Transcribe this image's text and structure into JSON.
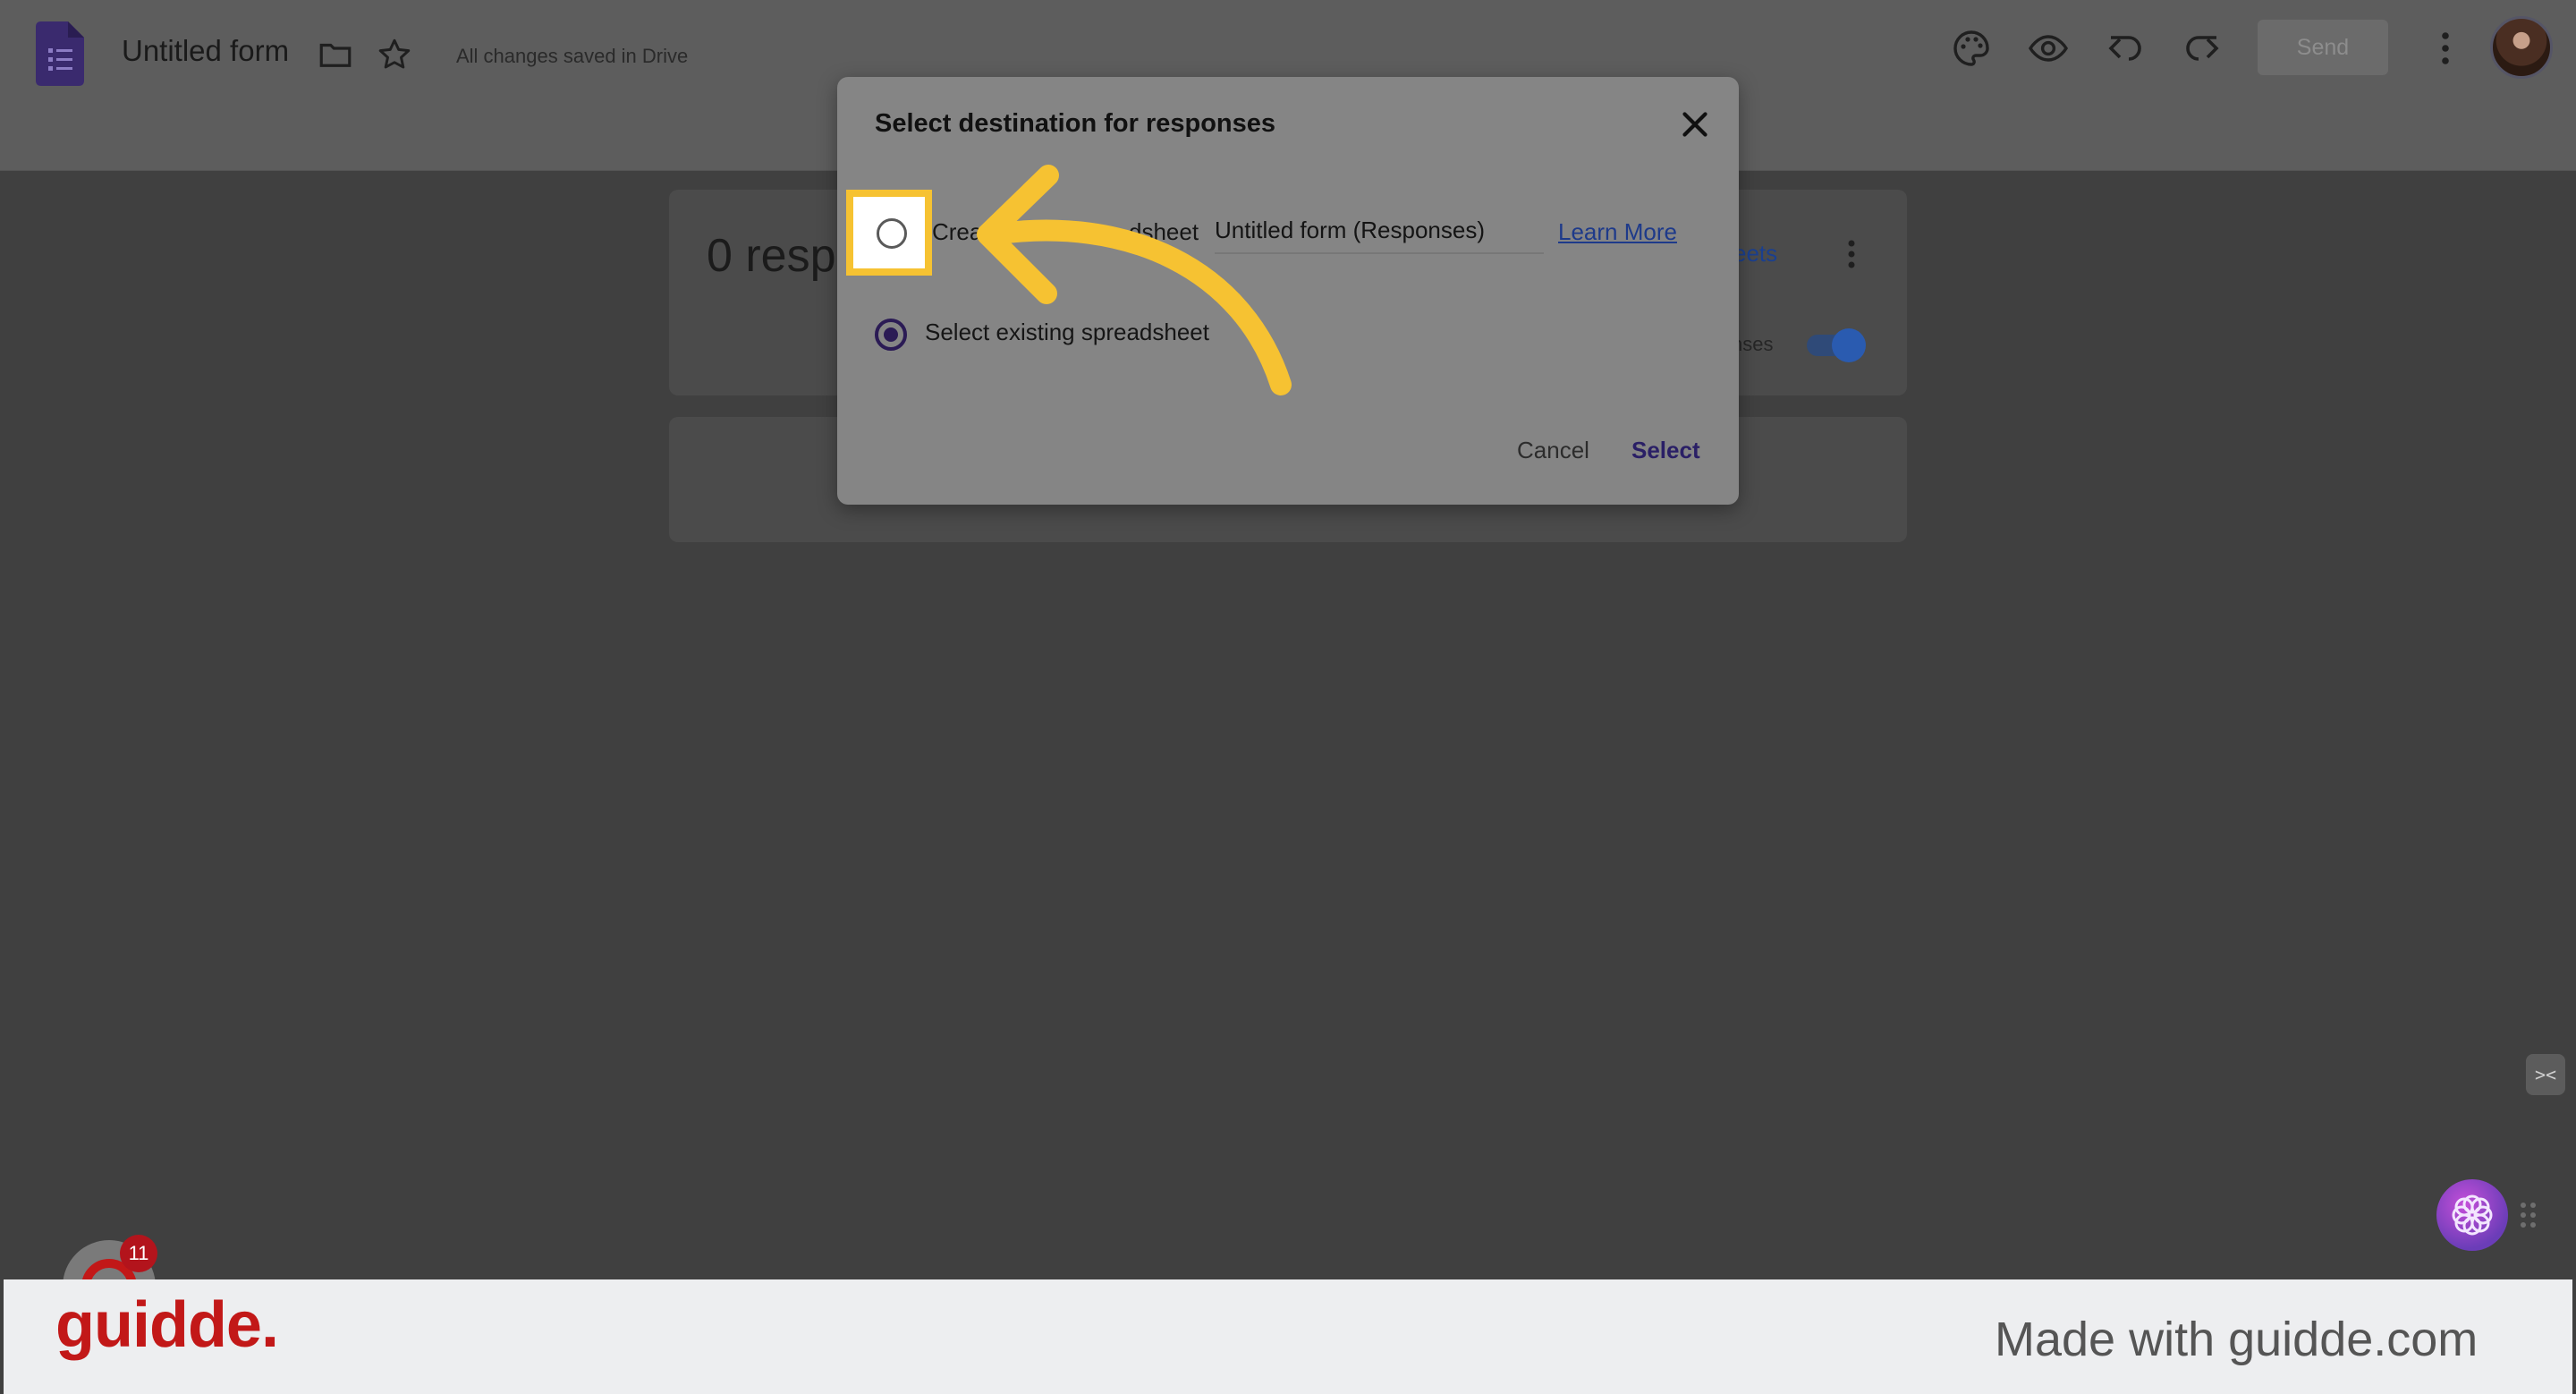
{
  "header": {
    "title": "Untitled form",
    "saved_status": "All changes saved in Drive",
    "send_label": "Send"
  },
  "responses": {
    "count_text": "0 resp",
    "sheets_link": "eets",
    "accepting_text": "nses"
  },
  "dialog": {
    "title": "Select destination for responses",
    "option_new": {
      "label_left": "Creat",
      "label_right": "dsheet",
      "name_value": "Untitled form (Responses)",
      "learn_more": "Learn More"
    },
    "option_existing": {
      "label": "Select existing spreadsheet"
    },
    "cancel_label": "Cancel",
    "select_label": "Select"
  },
  "guidde": {
    "badge_count": "11",
    "brand": "guidde.",
    "made_with": "Made with guidde.com"
  },
  "colors": {
    "highlight": "#f6c232",
    "brand_red": "#c21818"
  }
}
